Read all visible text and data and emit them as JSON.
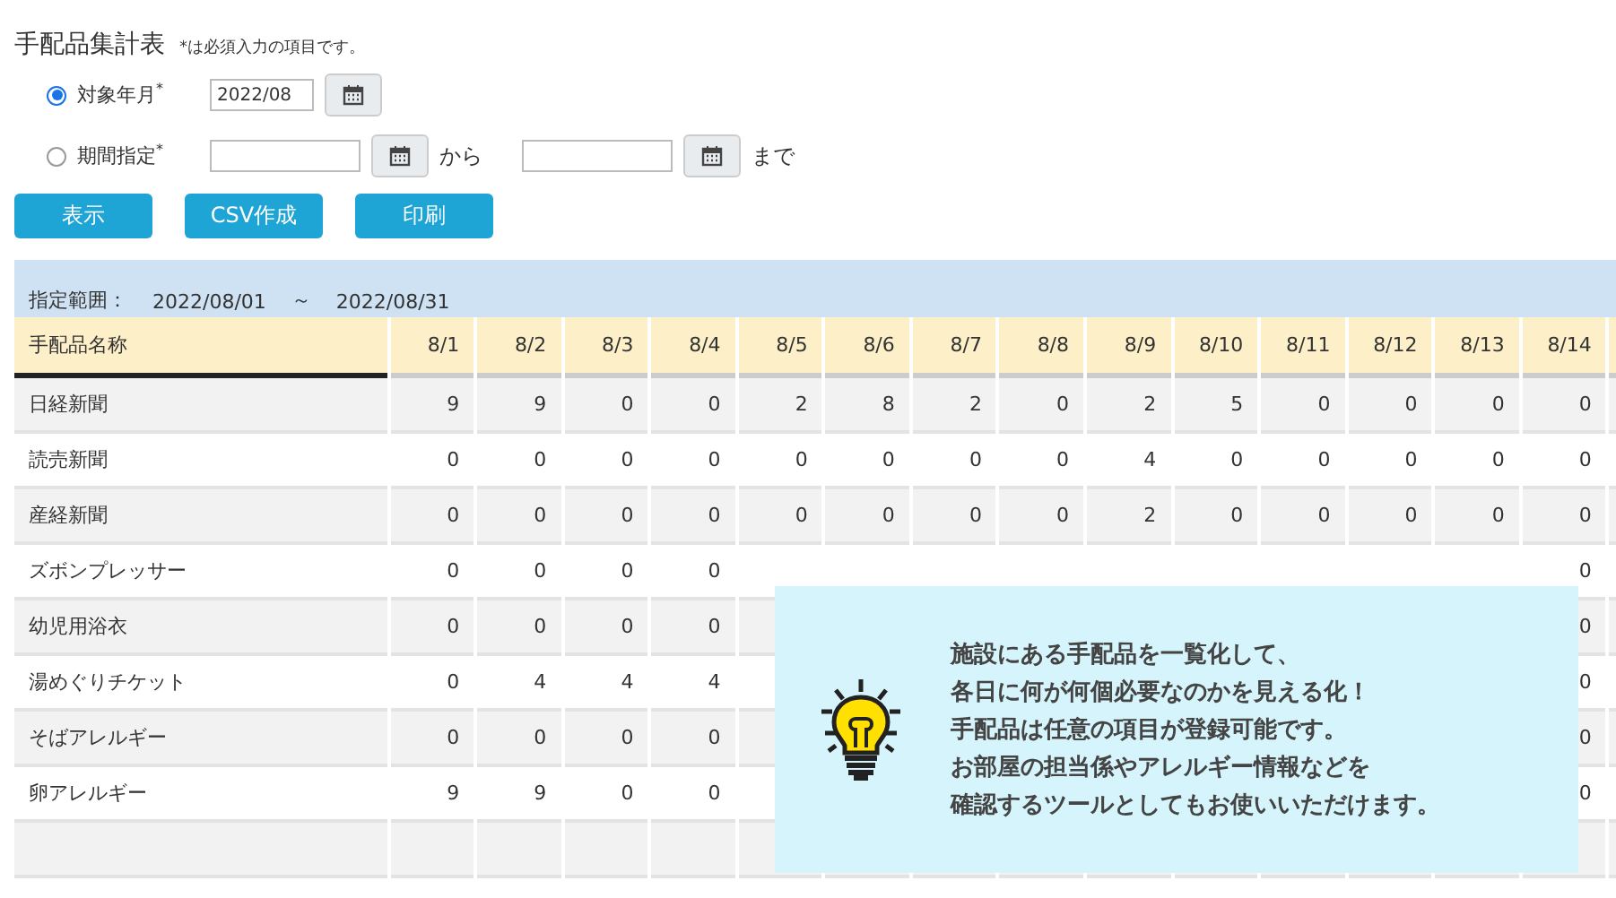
{
  "title": "手配品集計表",
  "required_note": "*は必須入力の項目です。",
  "options": [
    {
      "label": "対象年月",
      "required_mark": "*",
      "selected": true,
      "fields": [
        {
          "value": "2022/08"
        }
      ]
    },
    {
      "label": "期間指定",
      "required_mark": "*",
      "selected": false,
      "fields": [
        {
          "suffix": "から"
        },
        {
          "suffix": "まで"
        }
      ]
    }
  ],
  "buttons": [
    "表示",
    "CSV作成",
    "印刷"
  ],
  "range": {
    "label": "指定範囲：",
    "from": "2022/08/01",
    "separator": "～",
    "to": "2022/08/31"
  },
  "table": {
    "columns": [
      "手配品名称",
      "8/1",
      "8/2",
      "8/3",
      "8/4",
      "8/5",
      "8/6",
      "8/7",
      "8/8",
      "8/9",
      "8/10",
      "8/11",
      "8/12",
      "8/13",
      "8/14"
    ],
    "rows": [
      {
        "name": "日経新聞",
        "values": [
          "9",
          "9",
          "0",
          "0",
          "2",
          "8",
          "2",
          "0",
          "2",
          "5",
          "0",
          "0",
          "0",
          "0"
        ]
      },
      {
        "name": "読売新聞",
        "values": [
          "0",
          "0",
          "0",
          "0",
          "0",
          "0",
          "0",
          "0",
          "4",
          "0",
          "0",
          "0",
          "0",
          "0"
        ]
      },
      {
        "name": "産経新聞",
        "values": [
          "0",
          "0",
          "0",
          "0",
          "0",
          "0",
          "0",
          "0",
          "2",
          "0",
          "0",
          "0",
          "0",
          "0"
        ]
      },
      {
        "name": "ズボンプレッサー",
        "values": [
          "0",
          "0",
          "0",
          "0"
        ],
        "values_after_callout": [
          "0"
        ]
      },
      {
        "name": "幼児用浴衣",
        "values": [
          "0",
          "0",
          "0",
          "0"
        ],
        "values_after_callout": [
          "0"
        ]
      },
      {
        "name": "湯めぐりチケット",
        "values": [
          "0",
          "4",
          "4",
          "4"
        ],
        "values_after_callout": [
          "0"
        ]
      },
      {
        "name": "そばアレルギー",
        "values": [
          "0",
          "0",
          "0",
          "0"
        ],
        "values_after_callout": [
          "0"
        ]
      },
      {
        "name": "卵アレルギー",
        "values": [
          "9",
          "9",
          "0",
          "0"
        ],
        "values_after_callout": [
          "0"
        ]
      }
    ]
  },
  "callout": {
    "lines": [
      "施設にある手配品を一覧化して、",
      "各日に何が何個必要なのかを見える化！",
      "手配品は任意の項目が登録可能です。",
      "お部屋の担当係やアレルギー情報などを",
      "確認するツールとしてもお使いいただけます。"
    ]
  }
}
